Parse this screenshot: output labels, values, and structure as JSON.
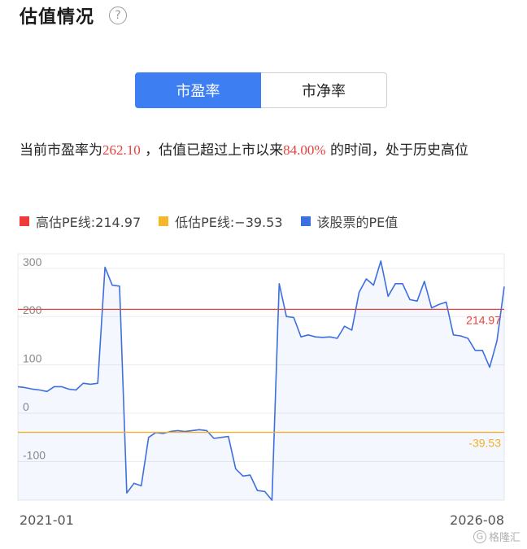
{
  "header": {
    "title": "估值情况",
    "help_icon": "?"
  },
  "tabs": [
    {
      "label": "市盈率",
      "active": true
    },
    {
      "label": "市净率",
      "active": false
    }
  ],
  "summary": {
    "prefix": "当前市盈率为",
    "pe_value": "262.10",
    "middle": " ，估值已超过上市以来",
    "percent": "84.00%",
    "suffix": " 的时间，处于历史高位"
  },
  "legend": [
    {
      "label": "高估PE线:214.97",
      "color": "#ee3a3a"
    },
    {
      "label": "低估PE线:−39.53",
      "color": "#f6b625"
    },
    {
      "label": "该股票的PE值",
      "color": "#3d6fe0"
    }
  ],
  "watermark": {
    "icon": "G",
    "text": "格隆汇"
  },
  "chart_data": {
    "type": "line",
    "x_start_label": "2021-01",
    "x_end_label": "2026-08",
    "y_ticks": [
      300,
      200,
      100,
      0,
      -100
    ],
    "y_tick_labels": [
      "300",
      "200",
      "100",
      "0",
      "-100"
    ],
    "ylim": [
      -180,
      330
    ],
    "grid": true,
    "high_line": {
      "value": 214.97,
      "label": "214.97",
      "color": "#e8413c"
    },
    "low_line": {
      "value": -39.53,
      "label": "-39.53",
      "color": "#f2b12a"
    },
    "series": [
      {
        "color": "#3d6fe0",
        "values": [
          55,
          53,
          50,
          48,
          45,
          55,
          55,
          50,
          48,
          62,
          60,
          62,
          302,
          265,
          263,
          -165,
          -145,
          -150,
          -50,
          -40,
          -42,
          -38,
          -36,
          -38,
          -36,
          -34,
          -36,
          -52,
          -50,
          -48,
          -115,
          -130,
          -128,
          -160,
          -162,
          -180,
          268,
          200,
          198,
          158,
          162,
          158,
          157,
          158,
          155,
          180,
          172,
          250,
          278,
          265,
          315,
          242,
          268,
          268,
          235,
          232,
          273,
          218,
          225,
          230,
          162,
          160,
          155,
          130,
          130,
          95,
          150,
          262
        ]
      }
    ]
  }
}
